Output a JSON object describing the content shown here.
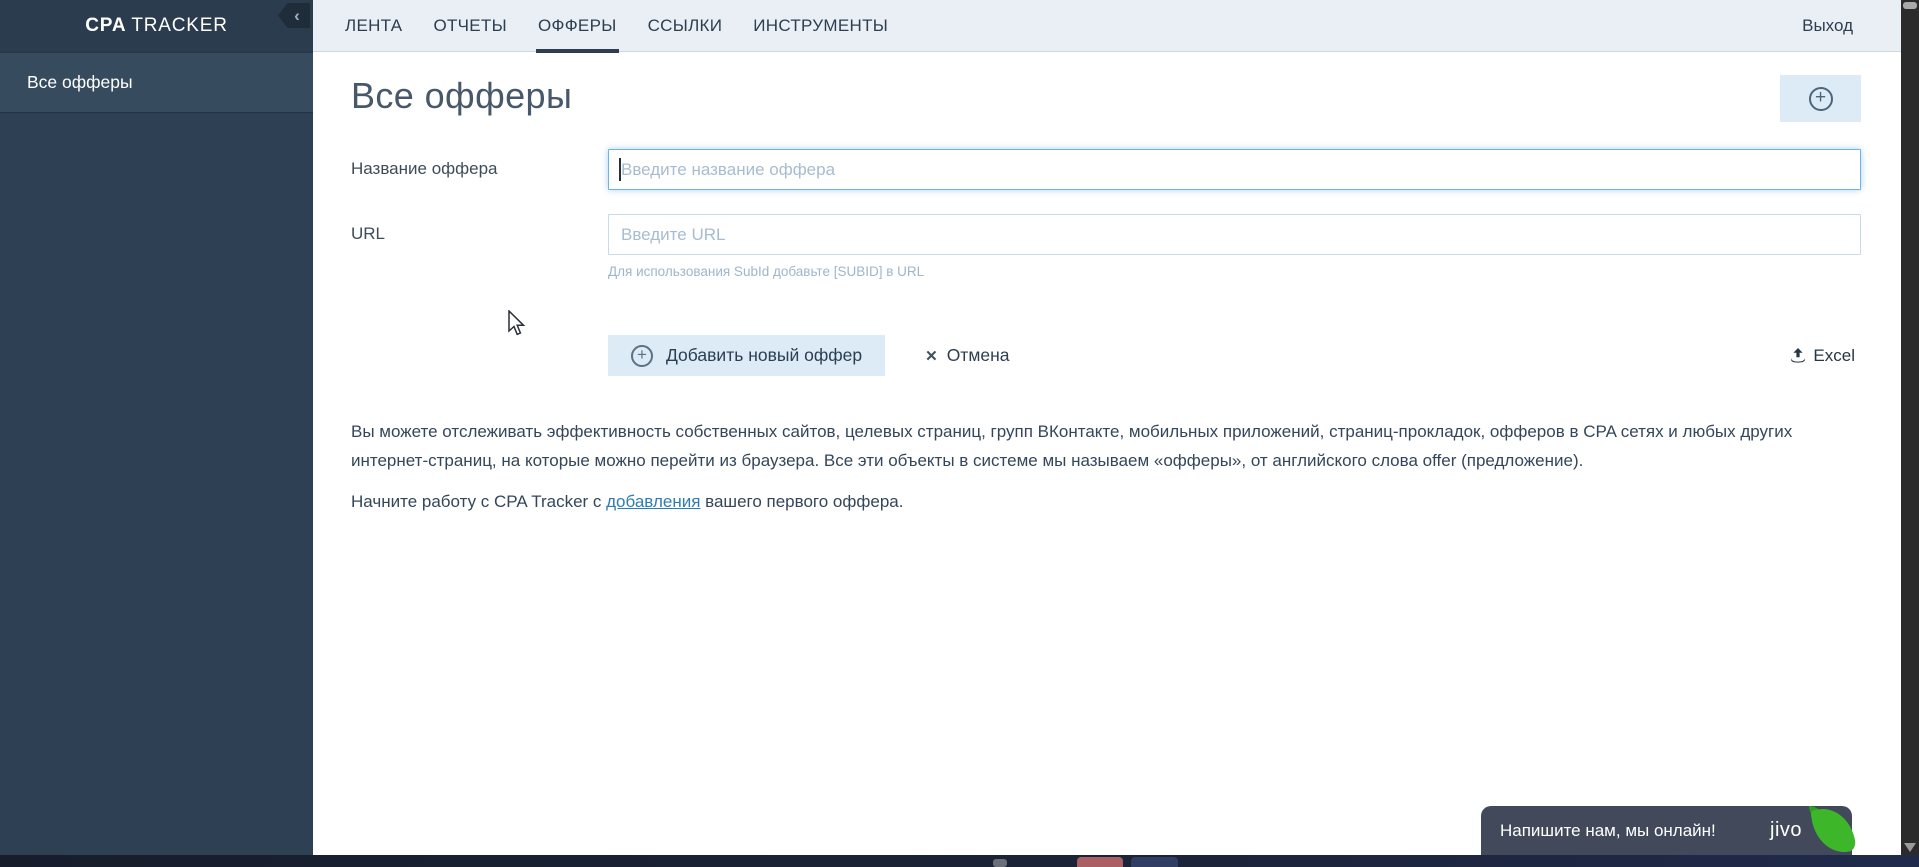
{
  "topbar": {
    "logo_bold": "CPA",
    "logo_rest": "TRACKER",
    "tabs": [
      {
        "label": "ЛЕНТА",
        "active": false
      },
      {
        "label": "ОТЧЕТЫ",
        "active": false
      },
      {
        "label": "ОФФЕРЫ",
        "active": true
      },
      {
        "label": "ССЫЛКИ",
        "active": false
      },
      {
        "label": "ИНСТРУМЕНТЫ",
        "active": false
      }
    ],
    "logout_label": "Выход"
  },
  "sidebar": {
    "items": [
      {
        "label": "Все офферы",
        "active": true
      }
    ]
  },
  "main": {
    "title": "Все офферы",
    "form": {
      "fields": [
        {
          "label": "Название оффера",
          "placeholder": "Введите название оффера",
          "value": "",
          "focused": true
        },
        {
          "label": "URL",
          "placeholder": "Введите URL",
          "value": "",
          "focused": false
        }
      ],
      "url_hint": "Для использования SubId добавьте [SUBID] в URL",
      "submit_label": "Добавить новый оффер",
      "cancel_label": "Отмена",
      "excel_label": "Excel"
    },
    "paragraph1": "Вы можете отслеживать эффективность собственных сайтов, целевых страниц, групп ВКонтакте, мобильных приложений, страниц-прокладок, офферов в CPA сетях и любых других интернет-страниц, на которые можно перейти из браузера. Все эти объекты в системе мы называем «офферы», от английского слова offer (предложение).",
    "paragraph2_prefix": "Начните работу с CPA Tracker с ",
    "paragraph2_link": "добавления",
    "paragraph2_suffix": " вашего первого оффера."
  },
  "chat": {
    "message": "Напишите нам, мы онлайн!",
    "brand": "jivo"
  },
  "icons": {
    "add": "+",
    "cancel": "✕",
    "collapse": "‹"
  },
  "colors": {
    "sidebar_bg": "#2e4053",
    "topbar_bg": "#2b3c4e",
    "sidebar_active_bg": "#374b5e",
    "nav_bg": "#e9eff5",
    "accent_dark": "#2c3e50",
    "button_bg": "#dcebf5",
    "focus_border": "#66afe9",
    "placeholder": "#a7bcd1",
    "link": "#2f7cb5",
    "jivo_bg": "#41495a",
    "jivo_green": "#3db629"
  }
}
